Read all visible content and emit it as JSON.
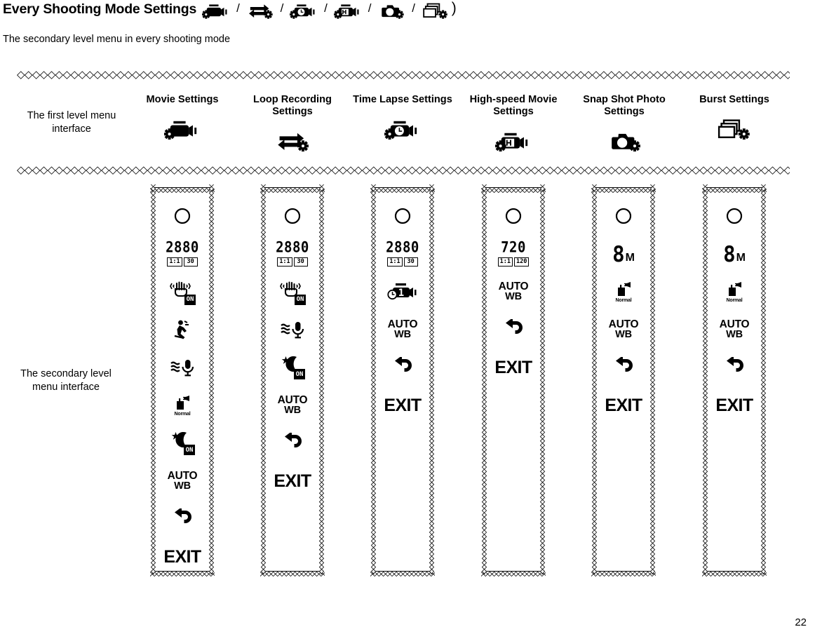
{
  "header": {
    "title": "Every Shooting Mode Settings",
    "separator": "/",
    "closing_paren": ")",
    "mode_icons": [
      "movie-settings-icon",
      "loop-recording-settings-icon",
      "time-lapse-settings-icon",
      "high-speed-movie-settings-icon",
      "snap-shot-photo-settings-icon",
      "burst-settings-icon"
    ],
    "subtitle": "The secondary level menu in every shooting mode"
  },
  "row_labels": {
    "first_level": "The first level menu interface",
    "second_level": "The secondary level menu interface"
  },
  "page_number": "22",
  "columns": [
    {
      "title": "Movie Settings",
      "icon": "movie-settings-icon",
      "items": [
        {
          "type": "circle",
          "name": "record-circle-icon"
        },
        {
          "type": "resolution",
          "value": "2880",
          "badges": [
            "1:1",
            "30"
          ],
          "name": "video-resolution-2880"
        },
        {
          "type": "anti-shake",
          "tag": "ON",
          "name": "anti-shake-icon"
        },
        {
          "type": "motion-detect",
          "name": "motion-detection-icon"
        },
        {
          "type": "audio",
          "name": "audio-recording-icon"
        },
        {
          "type": "quality",
          "label": "Normal",
          "name": "video-quality-normal-icon"
        },
        {
          "type": "night-mode",
          "tag": "ON",
          "name": "night-mode-icon"
        },
        {
          "type": "white-balance",
          "line1": "AUTO",
          "line2": "WB",
          "name": "white-balance-auto-icon"
        },
        {
          "type": "back-arrow",
          "name": "back-arrow-icon"
        },
        {
          "type": "exit",
          "label": "EXIT",
          "name": "exit-label"
        }
      ]
    },
    {
      "title": "Loop Recording Settings",
      "icon": "loop-recording-settings-icon",
      "items": [
        {
          "type": "circle",
          "name": "record-circle-icon"
        },
        {
          "type": "resolution",
          "value": "2880",
          "badges": [
            "1:1",
            "30"
          ],
          "name": "video-resolution-2880"
        },
        {
          "type": "anti-shake",
          "tag": "ON",
          "name": "anti-shake-icon"
        },
        {
          "type": "audio",
          "name": "audio-recording-icon"
        },
        {
          "type": "night-mode",
          "tag": "ON",
          "name": "night-mode-icon"
        },
        {
          "type": "white-balance",
          "line1": "AUTO",
          "line2": "WB",
          "name": "white-balance-auto-icon"
        },
        {
          "type": "back-arrow",
          "name": "back-arrow-icon"
        },
        {
          "type": "exit",
          "label": "EXIT",
          "name": "exit-label"
        }
      ]
    },
    {
      "title": "Time Lapse Settings",
      "icon": "time-lapse-settings-icon",
      "items": [
        {
          "type": "circle",
          "name": "record-circle-icon"
        },
        {
          "type": "resolution",
          "value": "2880",
          "badges": [
            "1:1",
            "30"
          ],
          "name": "video-resolution-2880"
        },
        {
          "type": "interval-camera",
          "value": "1",
          "name": "time-lapse-interval-icon"
        },
        {
          "type": "white-balance",
          "line1": "AUTO",
          "line2": "WB",
          "name": "white-balance-auto-icon"
        },
        {
          "type": "back-arrow",
          "name": "back-arrow-icon"
        },
        {
          "type": "exit",
          "label": "EXIT",
          "name": "exit-label"
        }
      ]
    },
    {
      "title": "High-speed Movie Settings",
      "icon": "high-speed-movie-settings-icon",
      "items": [
        {
          "type": "circle",
          "name": "record-circle-icon"
        },
        {
          "type": "resolution",
          "value": "720",
          "badges": [
            "1:1",
            "120"
          ],
          "name": "video-resolution-720"
        },
        {
          "type": "white-balance",
          "line1": "AUTO",
          "line2": "WB",
          "name": "white-balance-auto-icon"
        },
        {
          "type": "back-arrow",
          "name": "back-arrow-icon"
        },
        {
          "type": "exit",
          "label": "EXIT",
          "name": "exit-label"
        }
      ]
    },
    {
      "title": "Snap Shot Photo Settings",
      "icon": "snap-shot-photo-settings-icon",
      "items": [
        {
          "type": "circle",
          "name": "record-circle-icon"
        },
        {
          "type": "megapixel",
          "value": "8",
          "unit": "M",
          "name": "photo-resolution-8m"
        },
        {
          "type": "quality",
          "label": "Normal",
          "name": "photo-quality-normal-icon"
        },
        {
          "type": "white-balance",
          "line1": "AUTO",
          "line2": "WB",
          "name": "white-balance-auto-icon"
        },
        {
          "type": "back-arrow",
          "name": "back-arrow-icon"
        },
        {
          "type": "exit",
          "label": "EXIT",
          "name": "exit-label"
        }
      ]
    },
    {
      "title": "Burst Settings",
      "icon": "burst-settings-icon",
      "items": [
        {
          "type": "circle",
          "name": "record-circle-icon"
        },
        {
          "type": "megapixel",
          "value": "8",
          "unit": "M",
          "name": "photo-resolution-8m"
        },
        {
          "type": "quality",
          "label": "Normal",
          "name": "photo-quality-normal-icon"
        },
        {
          "type": "white-balance",
          "line1": "AUTO",
          "line2": "WB",
          "name": "white-balance-auto-icon"
        },
        {
          "type": "back-arrow",
          "name": "back-arrow-icon"
        },
        {
          "type": "exit",
          "label": "EXIT",
          "name": "exit-label"
        }
      ]
    }
  ],
  "colors": {
    "ink": "#000000",
    "paper": "#ffffff"
  }
}
